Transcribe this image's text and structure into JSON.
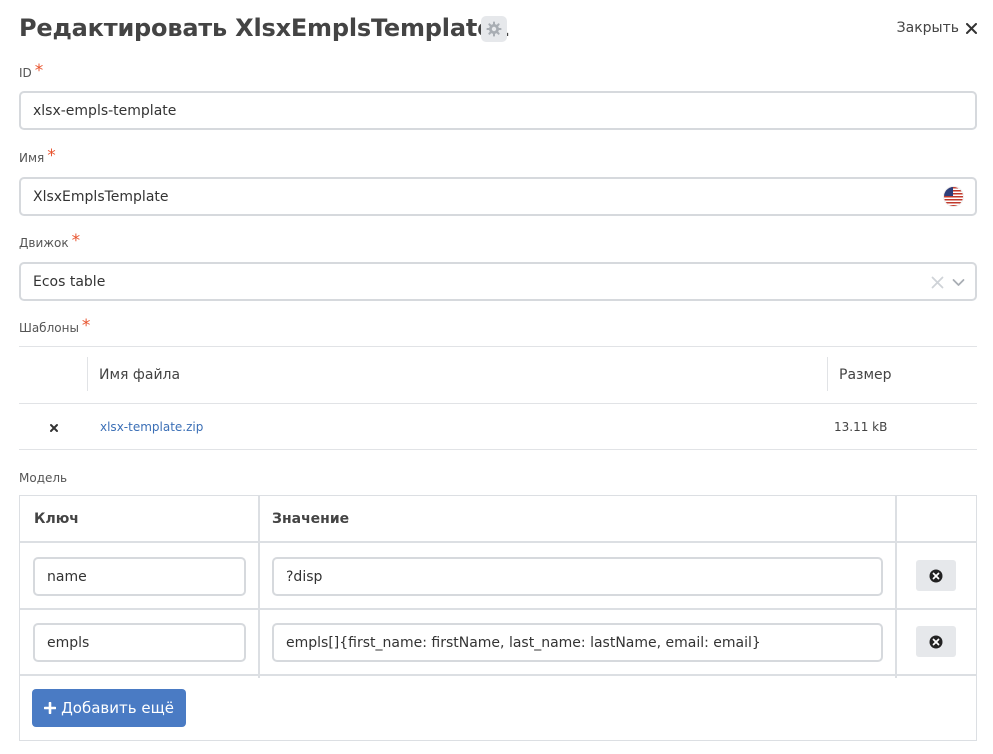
{
  "header": {
    "title": "Редактировать XlsxEmplsTemplate1",
    "close_label": "Закрыть",
    "settings_icon": "gear-icon",
    "close_icon": "close-icon"
  },
  "fields": {
    "id": {
      "label": "ID",
      "value": "xlsx-empls-template"
    },
    "name": {
      "label": "Имя",
      "value": "XlsxEmplsTemplate",
      "locale_icon": "us-flag-icon"
    },
    "engine": {
      "label": "Движок",
      "value": "Ecos table"
    },
    "templates": {
      "label": "Шаблоны"
    },
    "required_mark": "*"
  },
  "files": {
    "columns": [
      "Имя файла",
      "Размер"
    ],
    "rows": [
      {
        "name": "xlsx-template.zip",
        "size": "13.11 kB"
      }
    ]
  },
  "model": {
    "label": "Модель",
    "columns": [
      "Ключ",
      "Значение"
    ],
    "rows": [
      {
        "key": "name",
        "value": "?disp"
      },
      {
        "key": "empls",
        "value": "empls[]{first_name: firstName, last_name: lastName, email: email}"
      }
    ],
    "add_label": "Добавить ещё"
  },
  "colors": {
    "primary": "#4a7bc4",
    "required": "#e8542e",
    "link": "#3b6fb6",
    "border": "#d6d9dd"
  }
}
